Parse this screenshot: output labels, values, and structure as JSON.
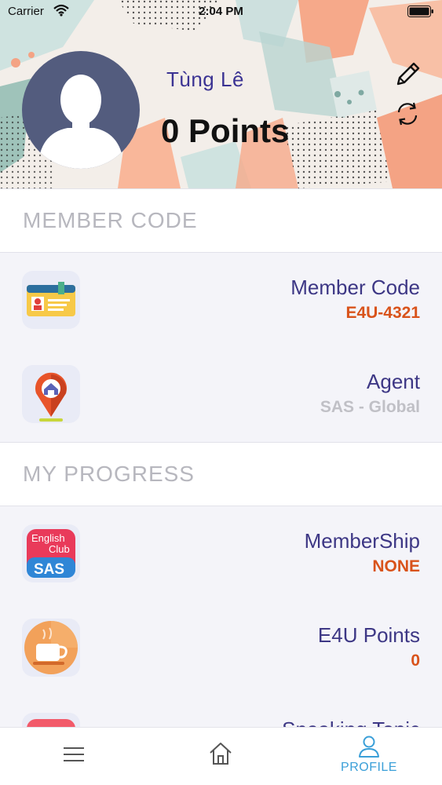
{
  "status_bar": {
    "carrier": "Carrier",
    "time": "2:04 PM"
  },
  "profile": {
    "name": "Tùng Lê",
    "points_text": "0 Points"
  },
  "sections": {
    "member_code_header": "MEMBER CODE",
    "progress_header": "MY PROGRESS"
  },
  "member_rows": [
    {
      "label": "Member Code",
      "value": "E4U-4321",
      "icon": "id-card-icon",
      "value_color": "#d9531b"
    },
    {
      "label": "Agent",
      "value": "SAS - Global",
      "icon": "location-pin-icon",
      "value_color": "#c0c0c6"
    }
  ],
  "progress_rows": [
    {
      "label": "MemberShip",
      "value": "NONE",
      "icon": "english-club-sas-icon",
      "value_color": "#d9531b"
    },
    {
      "label": "E4U Points",
      "value": "0",
      "icon": "coffee-cup-icon",
      "value_color": "#d9531b"
    },
    {
      "label": "Speaking Topic",
      "value": "",
      "icon": "speaking-topic-icon",
      "value_color": "#d9531b"
    }
  ],
  "english_club_icon_text": {
    "line1": "English",
    "line2": "Club",
    "line3": "SAS"
  },
  "tabbar": {
    "items": [
      {
        "label": "",
        "icon": "menu-icon"
      },
      {
        "label": "",
        "icon": "home-icon"
      },
      {
        "label": "PROFILE",
        "icon": "user-icon",
        "active": true
      }
    ],
    "active_color": "#3a9fd8"
  },
  "colors": {
    "accent_purple": "#3d3785",
    "accent_orange": "#d9531b",
    "avatar_bg": "#535c7e"
  }
}
